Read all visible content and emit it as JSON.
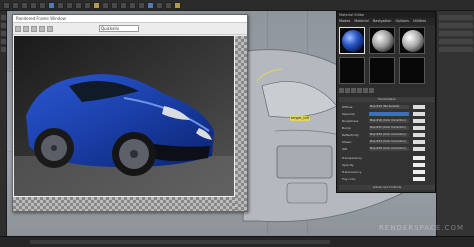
{
  "render_window": {
    "title": "Rendered Frame Window",
    "view_dropdown": "Quicksilv"
  },
  "material_editor": {
    "title": "Material Editor",
    "menu": [
      "Modes",
      "Material",
      "Navigation",
      "Options",
      "Utilities"
    ],
    "parameters_header": "Parameters",
    "rows": [
      {
        "label": "Diffuse",
        "value": "Map #10 (Tex Sample)"
      },
      {
        "label": "Specular",
        "value": ""
      },
      {
        "label": "Roughness",
        "value": "Map #16 (Color Correction)"
      },
      {
        "label": "Bump",
        "value": "Map #15 (Color Correction)"
      },
      {
        "label": "Reflectivity",
        "value": "Map #20 (Color Correction)"
      },
      {
        "label": "Sheen",
        "value": "Map #34 (Color Correction)"
      },
      {
        "label": "IOR",
        "value": "Map #28 (Color Correction)"
      }
    ],
    "lower_rows": [
      "Transparency",
      "Opacity",
      "Translucency",
      "Fog color"
    ],
    "section_bottom": "Advanced Controls"
  },
  "viewport": {
    "label_tag": "target_loft"
  },
  "watermark": "RENDERSPACE.COM",
  "colors": {
    "car_body": "#1f47b8",
    "ui_dark": "#2b2b2b",
    "viewport_grey": "#9aa0a6"
  }
}
